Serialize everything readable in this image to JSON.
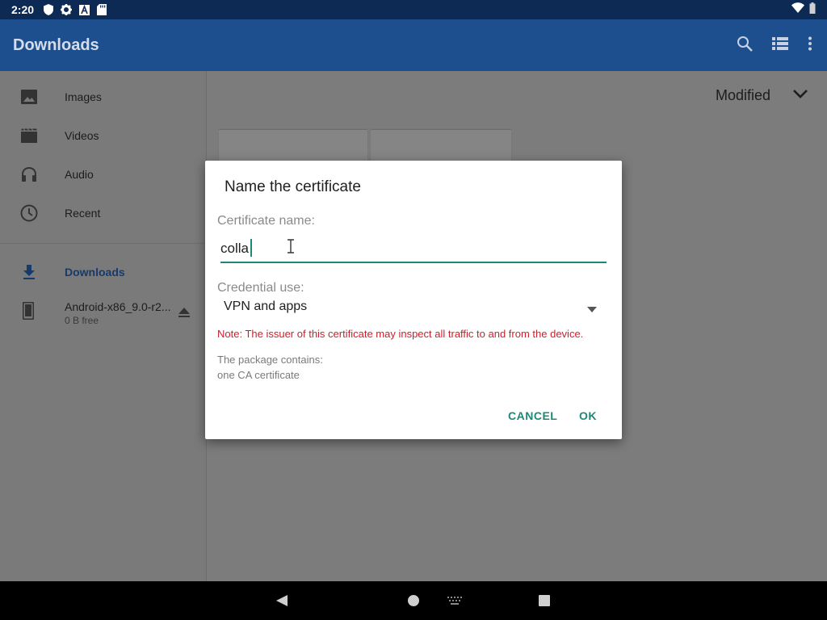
{
  "status_bar": {
    "time": "2:20",
    "icons": [
      "shield-icon",
      "settings-icon",
      "font-icon",
      "sd-card-icon"
    ],
    "right_icons": [
      "wifi-icon",
      "battery-icon"
    ]
  },
  "app_bar": {
    "title": "Downloads",
    "actions": [
      "search-icon",
      "list-view-icon",
      "more-vert-icon"
    ]
  },
  "drawer": {
    "items": [
      {
        "label": "Images",
        "icon": "image-icon"
      },
      {
        "label": "Videos",
        "icon": "video-icon"
      },
      {
        "label": "Audio",
        "icon": "headphones-icon"
      },
      {
        "label": "Recent",
        "icon": "clock-icon"
      }
    ],
    "downloads_label": "Downloads",
    "root": {
      "label": "Android-x86_9.0-r2...",
      "sub": "0 B free",
      "icon": "phone-icon"
    }
  },
  "content": {
    "sort_label": "Modified"
  },
  "dialog": {
    "title": "Name the certificate",
    "name_label": "Certificate name:",
    "name_value": "colla",
    "use_label": "Credential use:",
    "use_value": "VPN and apps",
    "note": "Note: The issuer of this certificate may inspect all traffic to and from the device.",
    "package_line1": "The package contains:",
    "package_line2": "one CA certificate",
    "cancel_label": "CANCEL",
    "ok_label": "OK"
  },
  "colors": {
    "accent": "#1e8878",
    "appbar": "#1d4f8f",
    "statusbar": "#0d2a54",
    "warning": "#cc1f2a"
  }
}
